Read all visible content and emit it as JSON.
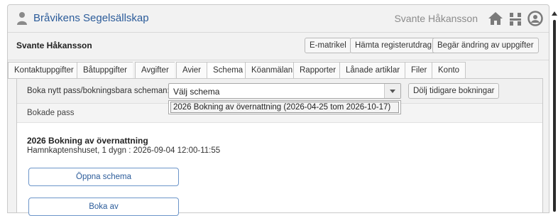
{
  "header": {
    "org_name": "Bråvikens Segelsällskap",
    "user_name": "Svante Håkansson",
    "icons": [
      "person-icon",
      "home-icon",
      "organization-icon",
      "user-circle-icon"
    ],
    "brand_color": "#2c5c9a"
  },
  "member": {
    "name": "Svante Håkansson",
    "buttons": {
      "ematrikel": "E-matrikel",
      "hamta": "Hämta registerutdrag",
      "begar": "Begär ändring av uppgifter"
    }
  },
  "tabs": [
    {
      "label": "Kontaktuppgifter"
    },
    {
      "label": "Båtuppgifter"
    },
    {
      "label": "Avgifter"
    },
    {
      "label": "Avier"
    },
    {
      "label": "Schema",
      "active": true
    },
    {
      "label": "Köanmälan"
    },
    {
      "label": "Rapporter"
    },
    {
      "label": "Lånade artiklar"
    },
    {
      "label": "Filer"
    },
    {
      "label": "Konto"
    }
  ],
  "schema": {
    "book_label": "Boka nytt pass/bokningsbara scheman:",
    "select_value": "Välj schema",
    "dropdown_option": "2026 Bokning av övernattning (2026-04-25 tom 2026-10-17)",
    "hide_button": "Dölj tidigare bokningar",
    "section_title": "Bokade pass",
    "booked_item": {
      "title": "2026 Bokning av övernattning",
      "details": "Hamnkaptenshuset, 1 dygn : 2026-09-04 12:00-11:55"
    },
    "open_button": "Öppna schema",
    "cancel_button": "Boka av"
  }
}
